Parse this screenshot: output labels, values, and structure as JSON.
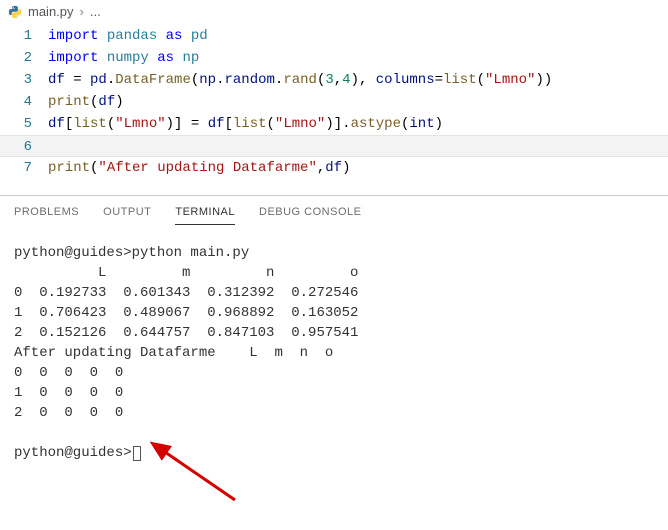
{
  "breadcrumb": {
    "file_icon": "python-file-icon",
    "file": "main.py",
    "sep": "›",
    "ellipsis": "..."
  },
  "editor": {
    "lines": [
      {
        "n": "1",
        "tokens": [
          [
            "kw",
            "import"
          ],
          [
            "",
            ""
          ],
          [
            "mod",
            "pandas"
          ],
          [
            "",
            ""
          ],
          [
            "kw",
            "as"
          ],
          [
            "",
            ""
          ],
          [
            "mod",
            "pd"
          ]
        ]
      },
      {
        "n": "2",
        "tokens": [
          [
            "kw",
            "import"
          ],
          [
            "",
            ""
          ],
          [
            "mod",
            "numpy"
          ],
          [
            "",
            ""
          ],
          [
            "kw",
            "as"
          ],
          [
            "",
            ""
          ],
          [
            "mod",
            "np"
          ]
        ]
      },
      {
        "n": "3",
        "tokens": [
          [
            "var",
            "df"
          ],
          [
            "op",
            " = "
          ],
          [
            "var",
            "pd"
          ],
          [
            "op",
            "."
          ],
          [
            "fn",
            "DataFrame"
          ],
          [
            "paren",
            "("
          ],
          [
            "var",
            "np"
          ],
          [
            "op",
            "."
          ],
          [
            "var",
            "random"
          ],
          [
            "op",
            "."
          ],
          [
            "fn",
            "rand"
          ],
          [
            "paren",
            "("
          ],
          [
            "num",
            "3"
          ],
          [
            "op",
            ","
          ],
          [
            "num",
            "4"
          ],
          [
            "paren",
            ")"
          ],
          [
            "op",
            ", "
          ],
          [
            "var",
            "columns"
          ],
          [
            "op",
            "="
          ],
          [
            "fn",
            "list"
          ],
          [
            "paren",
            "("
          ],
          [
            "str",
            "\"Lmno\""
          ],
          [
            "paren",
            "))"
          ]
        ]
      },
      {
        "n": "4",
        "tokens": [
          [
            "fn",
            "print"
          ],
          [
            "paren",
            "("
          ],
          [
            "var",
            "df"
          ],
          [
            "paren",
            ")"
          ]
        ]
      },
      {
        "n": "5",
        "tokens": [
          [
            "var",
            "df"
          ],
          [
            "paren",
            "["
          ],
          [
            "fn",
            "list"
          ],
          [
            "paren",
            "("
          ],
          [
            "str",
            "\"Lmno\""
          ],
          [
            "paren",
            ")]"
          ],
          [
            "op",
            " = "
          ],
          [
            "var",
            "df"
          ],
          [
            "paren",
            "["
          ],
          [
            "fn",
            "list"
          ],
          [
            "paren",
            "("
          ],
          [
            "str",
            "\"Lmno\""
          ],
          [
            "paren",
            ")]"
          ],
          [
            "op",
            "."
          ],
          [
            "fn",
            "astype"
          ],
          [
            "paren",
            "("
          ],
          [
            "var",
            "int"
          ],
          [
            "paren",
            ")"
          ]
        ]
      },
      {
        "n": "6",
        "tokens": []
      },
      {
        "n": "7",
        "tokens": [
          [
            "fn",
            "print"
          ],
          [
            "paren",
            "("
          ],
          [
            "str",
            "\"After updating Datafarme\""
          ],
          [
            "op",
            ","
          ],
          [
            "var",
            "df"
          ],
          [
            "paren",
            ")"
          ]
        ]
      }
    ]
  },
  "panel": {
    "tabs": {
      "problems": "PROBLEMS",
      "output": "OUTPUT",
      "terminal": "TERMINAL",
      "debug": "DEBUG CONSOLE"
    },
    "active": "terminal"
  },
  "terminal": {
    "prompt1": "python@guides>",
    "cmd1": "python main.py",
    "header": "          L         m         n         o",
    "rows_float": [
      "0  0.192733  0.601343  0.312392  0.272546",
      "1  0.706423  0.489067  0.968892  0.163052",
      "2  0.152126  0.644757  0.847103  0.957541"
    ],
    "after_label": "After updating Datafarme    L  m  n  o",
    "rows_int": [
      "0  0  0  0  0",
      "1  0  0  0  0",
      "2  0  0  0  0"
    ],
    "prompt2": "python@guides>"
  },
  "chart_data": {
    "type": "table",
    "title": "DataFrame output before and after astype(int)",
    "float_table": {
      "columns": [
        "L",
        "m",
        "n",
        "o"
      ],
      "rows": [
        [
          0.192733,
          0.601343,
          0.312392,
          0.272546
        ],
        [
          0.706423,
          0.489067,
          0.968892,
          0.163052
        ],
        [
          0.152126,
          0.644757,
          0.847103,
          0.957541
        ]
      ]
    },
    "int_table": {
      "columns": [
        "L",
        "m",
        "n",
        "o"
      ],
      "rows": [
        [
          0,
          0,
          0,
          0
        ],
        [
          0,
          0,
          0,
          0
        ],
        [
          0,
          0,
          0,
          0
        ]
      ]
    }
  }
}
